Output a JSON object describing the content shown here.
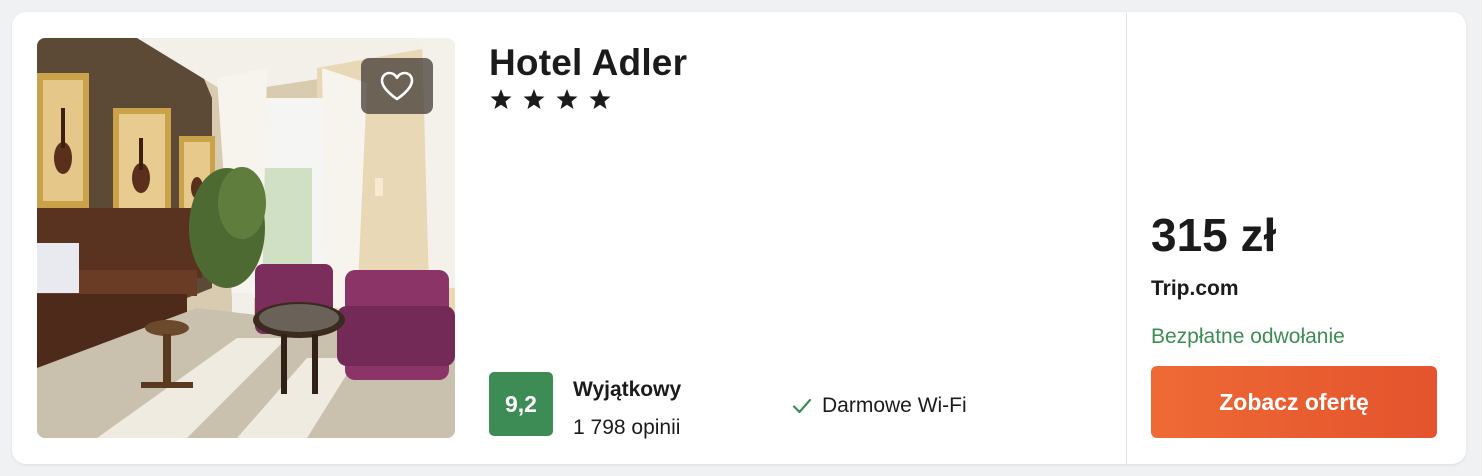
{
  "hotel": {
    "name": "Hotel Adler",
    "star_count": 4,
    "star_glyph": "★",
    "photo_description_icon": "hotel-lobby-photo",
    "favorite_icon": "heart-outline-icon"
  },
  "rating": {
    "score": "9,2",
    "label": "Wyjątkowy",
    "reviews": "1 798 opinii",
    "badge_color": "#3e8c55"
  },
  "amenities": [
    {
      "icon": "checkmark-icon",
      "label": "Darmowe Wi-Fi"
    }
  ],
  "offer": {
    "price": "315 zł",
    "provider": "Trip.com",
    "cancellation": "Bezpłatne odwołanie",
    "cancellation_color": "#3e8c55",
    "cta_label": "Zobacz ofertę",
    "cta_color": "#e85e31"
  }
}
